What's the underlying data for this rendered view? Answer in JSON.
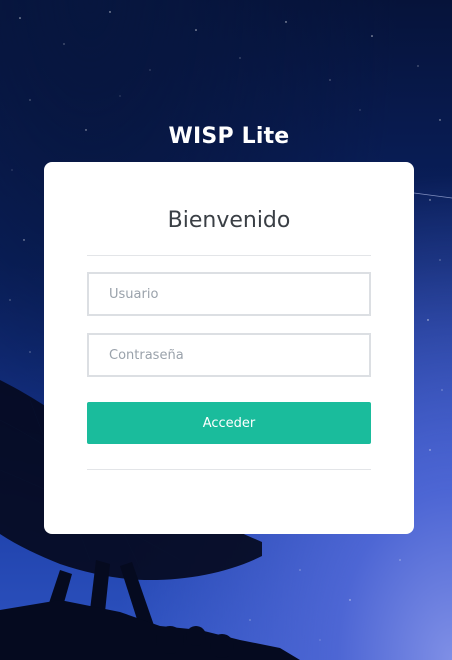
{
  "brand": {
    "title": "WISP Lite"
  },
  "login": {
    "heading": "Bienvenido",
    "username": {
      "placeholder": "Usuario",
      "value": ""
    },
    "password": {
      "placeholder": "Contraseña",
      "value": ""
    },
    "submit_label": "Acceder",
    "accent_color": "#1abc9c"
  },
  "background": {
    "description_icon": "night-sky-radio-telescope-image"
  }
}
